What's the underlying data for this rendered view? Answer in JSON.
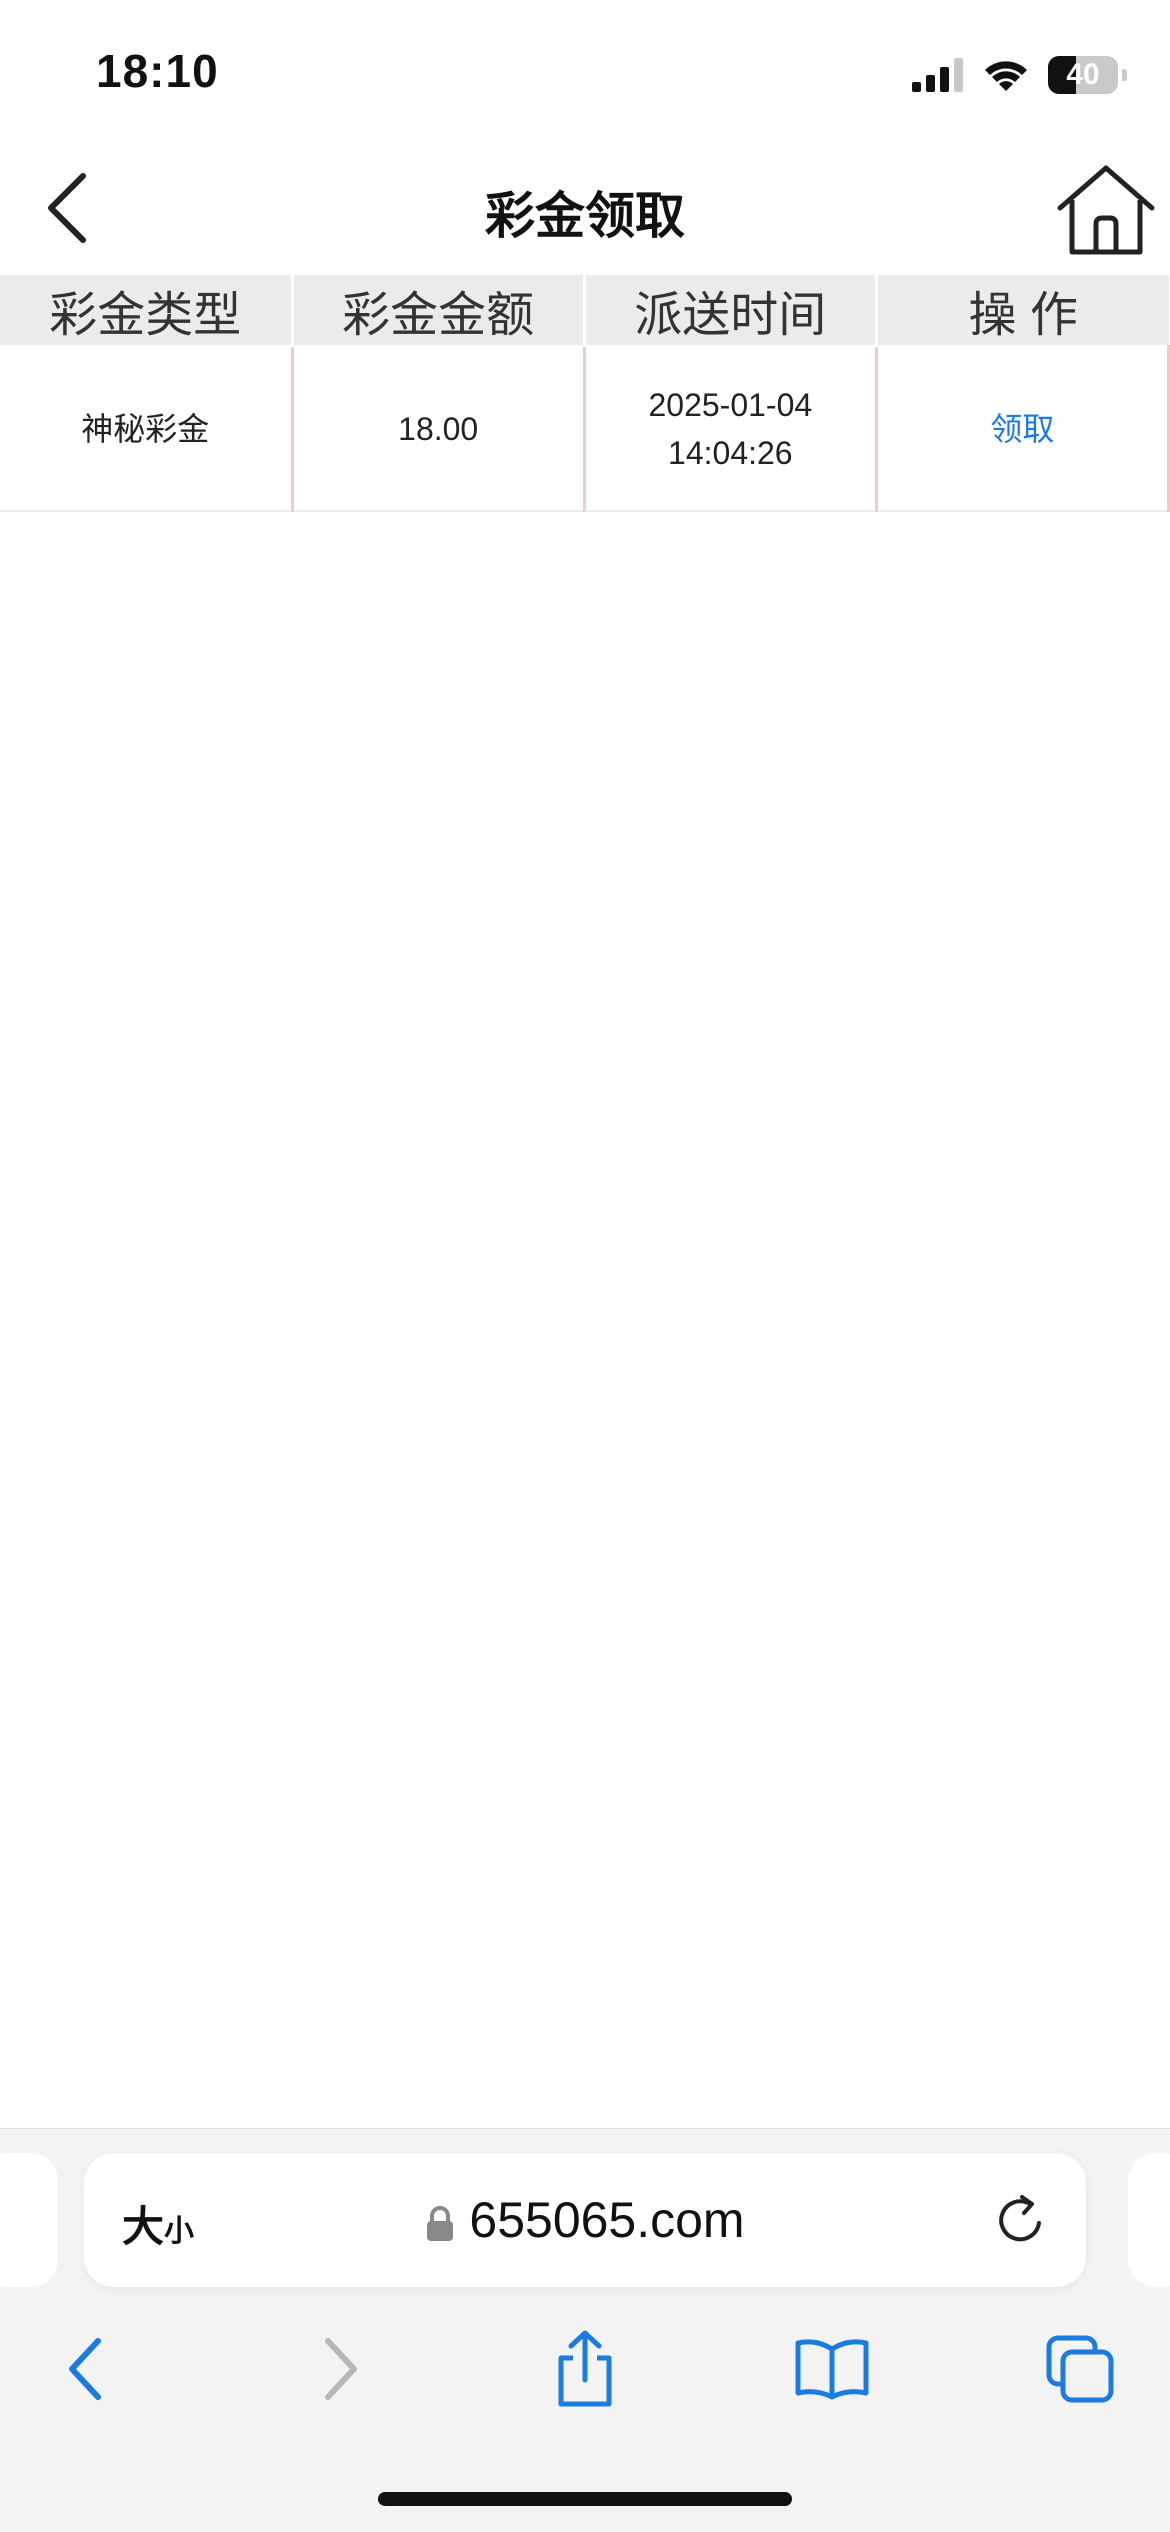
{
  "status_bar": {
    "time": "18:10",
    "battery": "40",
    "battery_level": 0.4,
    "icons": [
      "signal-icon",
      "wifi-icon",
      "battery-icon"
    ]
  },
  "header": {
    "title": "彩金领取",
    "back_icon": "chevron-left-icon",
    "home_icon": "home-icon"
  },
  "table": {
    "columns": [
      "彩金类型",
      "彩金金额",
      "派送时间",
      "操 作"
    ],
    "rows": [
      {
        "type": "神秘彩金",
        "amount": "18.00",
        "date": "2025-01-04",
        "time": "14:04:26",
        "action": "领取"
      }
    ]
  },
  "browser": {
    "text_size_label_big": "大",
    "text_size_label_small": "小",
    "url": "655065.com",
    "toolbar_icons": [
      "back-icon",
      "forward-icon",
      "share-icon",
      "bookmarks-icon",
      "tabs-icon"
    ],
    "accent_color": "#1a7ce0"
  }
}
